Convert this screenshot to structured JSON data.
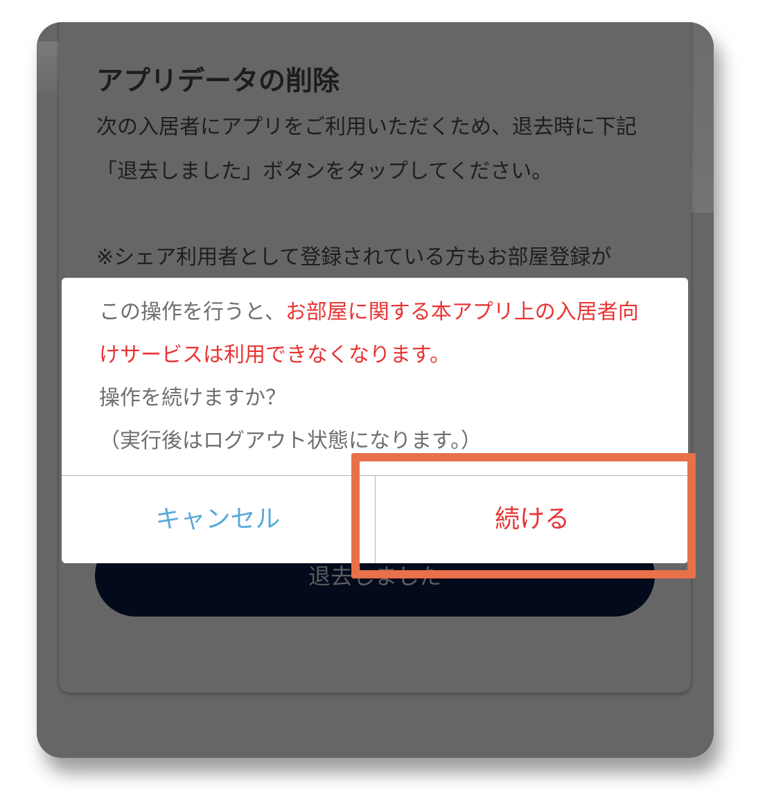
{
  "card": {
    "title": "アプリデータの削除",
    "body": "次の入居者にアプリをご利用いただくため、退去時に下記「退去しました」ボタンをタップしてください。",
    "note": "※シェア利用者として登録されている方もお部屋登録が",
    "button_label": "退去しました"
  },
  "dialog": {
    "message_prefix": "この操作を行うと、",
    "message_warning": "お部屋に関する本アプリ上の入居者向けサービスは利用できなくなります。",
    "confirm_question": "操作を続けますか？",
    "logout_note": "（実行後はログアウト状態になります。）",
    "cancel_label": "キャンセル",
    "continue_label": "続ける"
  },
  "colors": {
    "overlay": "#666666",
    "danger": "#e83434",
    "cancel": "#5aa9da",
    "primary_button": "#020a1c",
    "highlight": "#e8704a"
  }
}
